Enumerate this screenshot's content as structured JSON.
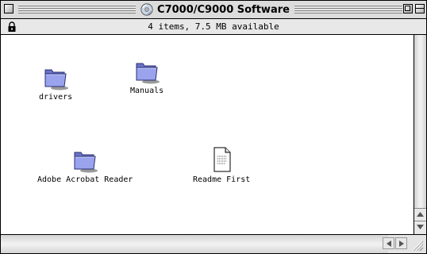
{
  "window": {
    "title": "C7000/C9000 Software",
    "info": "4 items, 7.5 MB available",
    "accent": "#dcdcdc"
  },
  "items": [
    {
      "label": "drivers",
      "icon": "folder-icon"
    },
    {
      "label": "Manuals",
      "icon": "folder-icon"
    },
    {
      "label": "Adobe Acrobat Reader",
      "icon": "folder-icon"
    },
    {
      "label": "Readme First",
      "icon": "document-icon"
    }
  ]
}
